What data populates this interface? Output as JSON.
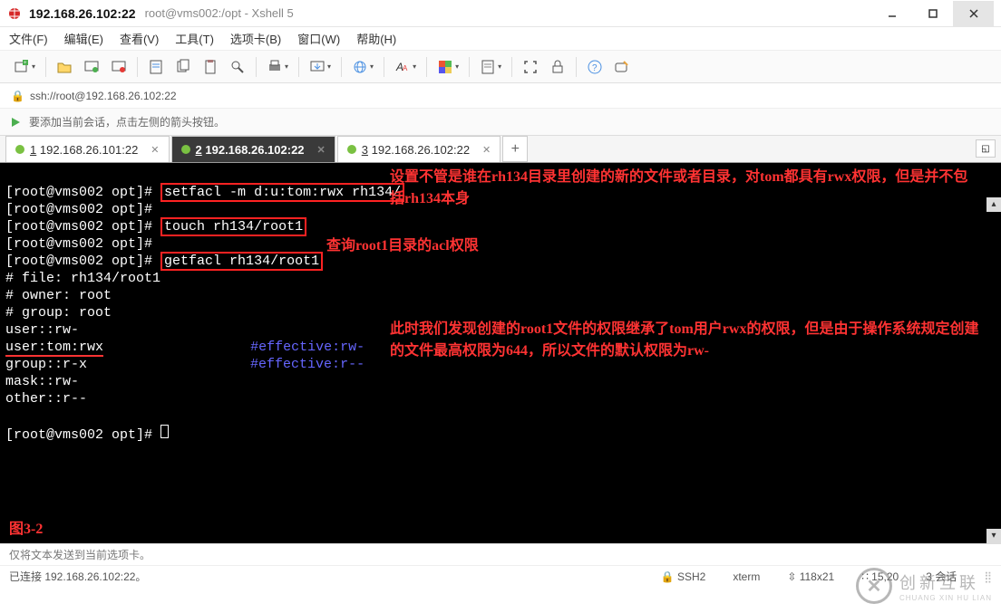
{
  "titlebar": {
    "address": "192.168.26.102:22",
    "path": "root@vms002:/opt - Xshell 5"
  },
  "menu": {
    "file": "文件(F)",
    "edit": "编辑(E)",
    "view": "查看(V)",
    "tools": "工具(T)",
    "tabs": "选项卡(B)",
    "window": "窗口(W)",
    "help": "帮助(H)"
  },
  "addressbar": {
    "url": "ssh://root@192.168.26.102:22"
  },
  "infobar": {
    "text": "要添加当前会话，点击左侧的箭头按钮。"
  },
  "tabs": [
    {
      "num": "1",
      "label": "192.168.26.101:22",
      "active": false
    },
    {
      "num": "2",
      "label": "192.168.26.102:22",
      "active": true
    },
    {
      "num": "3",
      "label": "192.168.26.102:22",
      "active": false
    }
  ],
  "terminal": {
    "prompt": "[root@vms002 opt]#",
    "cmd1": "setfacl -m d:u:tom:rwx rh134/",
    "cmd2": "touch rh134/root1",
    "cmd3": "getfacl rh134/root1",
    "out_file": "# file: rh134/root1",
    "out_owner": "# owner: root",
    "out_group": "# group: root",
    "out_user": "user::rw-",
    "out_usertom": "user:tom:rwx",
    "eff1": "#effective:rw-",
    "out_groupline": "group::r-x",
    "eff2": "#effective:r--",
    "out_mask": "mask::rw-",
    "out_other": "other::r--",
    "ann1": "设置不管是谁在rh134目录里创建的新的文件或者目录，对tom都具有rwx权限，但是并不包括rh134本身",
    "ann2": "查询root1目录的acl权限",
    "ann3": "此时我们发现创建的root1文件的权限继承了tom用户rwx的权限，但是由于操作系统规定创建的文件最高权限为644，所以文件的默认权限为rw-",
    "figure": "图3-2"
  },
  "footer1": "仅将文本发送到当前选项卡。",
  "footer2": {
    "status": "已连接 192.168.26.102:22。",
    "ssh": "SSH2",
    "term": "xterm",
    "size": "118x21",
    "pos": "15,20",
    "sessions": "3 会话"
  },
  "watermark": {
    "cn": "创新互联",
    "py": "CHUANG XIN HU LIAN"
  }
}
